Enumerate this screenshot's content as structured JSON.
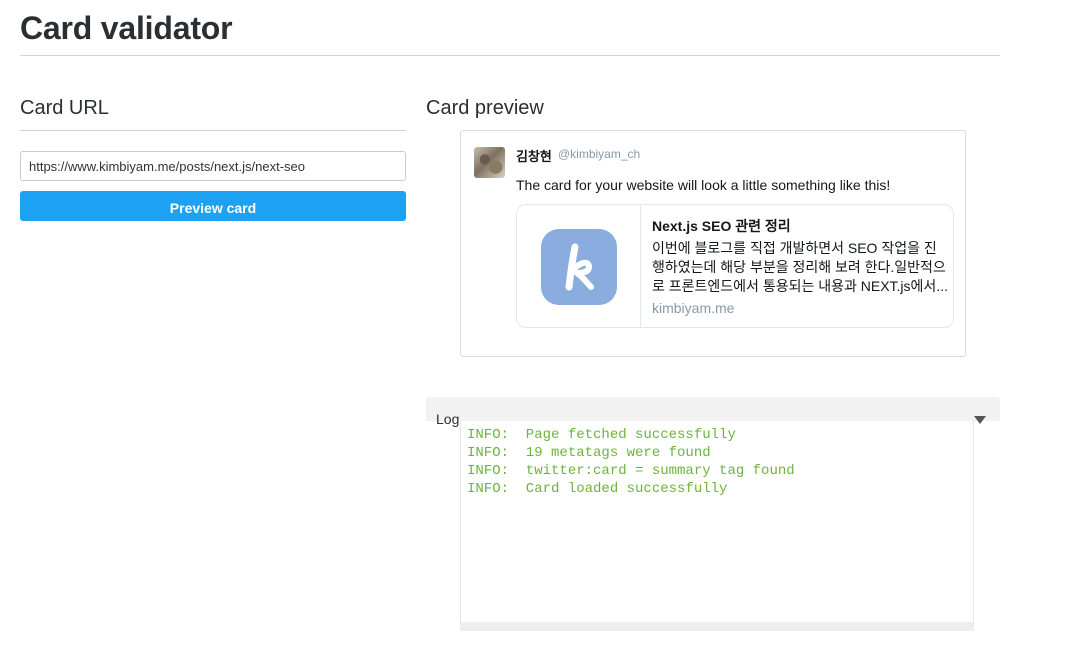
{
  "page": {
    "title": "Card validator"
  },
  "url_section": {
    "heading": "Card URL",
    "input_value": "https://www.kimbiyam.me/posts/next.js/next-seo",
    "button_label": "Preview card"
  },
  "preview_section": {
    "heading": "Card preview",
    "tweet": {
      "user_name": "김창현",
      "user_handle": "@kimbiyam_ch",
      "text": "The card for your website will look a little something like this!",
      "avatar_icon": "user-avatar-photo",
      "card": {
        "logo_letter": "k",
        "logo_color": "#8aacdf",
        "title": "Next.js SEO 관련 정리",
        "description": "이번에 블로그를 직접 개발하면서 SEO 작업을 진행하였는데 해당 부분을 정리해 보려 한다.일반적으로 프론트엔드에서 통용되는 내용과 NEXT.js에서...",
        "domain": "kimbiyam.me"
      }
    }
  },
  "log": {
    "label": "Log",
    "toggle_icon": "triangle-down-icon",
    "lines": [
      "INFO:  Page fetched successfully",
      "INFO:  19 metatags were found",
      "INFO:  twitter:card = summary tag found",
      "INFO:  Card loaded successfully"
    ],
    "text_color": "#6db33f"
  },
  "colors": {
    "button": "#1da1f2",
    "handle": "#8899a6"
  }
}
